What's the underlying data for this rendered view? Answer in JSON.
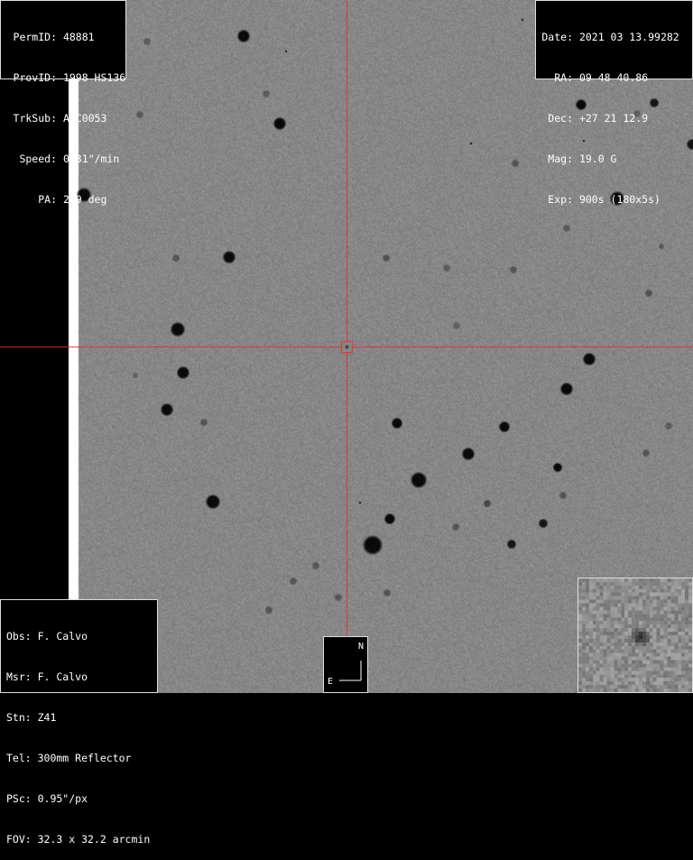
{
  "top_left": {
    "rows": [
      {
        "label": "PermID:",
        "value": "48881"
      },
      {
        "label": "ProvID:",
        "value": "1998 HS136"
      },
      {
        "label": "TrkSub:",
        "value": "ABC0053"
      },
      {
        "label": "Speed:",
        "value": "0.31\"/min"
      },
      {
        "label": "PA:",
        "value": "269 deg"
      }
    ]
  },
  "top_right": {
    "rows": [
      {
        "label": "Date:",
        "value": "2021 03 13.99282"
      },
      {
        "label": "RA:",
        "value": "09 48 40.86"
      },
      {
        "label": "Dec:",
        "value": "+27 21 12.9"
      },
      {
        "label": "Mag:",
        "value": "19.0 G"
      },
      {
        "label": "Exp:",
        "value": "900s (180x5s)"
      }
    ]
  },
  "bottom_left": {
    "rows": [
      "Obs: F. Calvo",
      "Msr: F. Calvo",
      "Stn: Z41",
      "Tel: 300mm Reflector",
      "PSc: 0.95\"/px",
      "FOV: 32.3 x 32.2 arcmin"
    ]
  },
  "compass": {
    "north": "N",
    "east": "E"
  },
  "colors": {
    "crosshair": "#e23030",
    "background": "#8d8d8d",
    "star": "#0a0a0a",
    "text": "#ffffff"
  },
  "icons": {
    "compass": "compass-icon",
    "target": "target-box-icon"
  }
}
